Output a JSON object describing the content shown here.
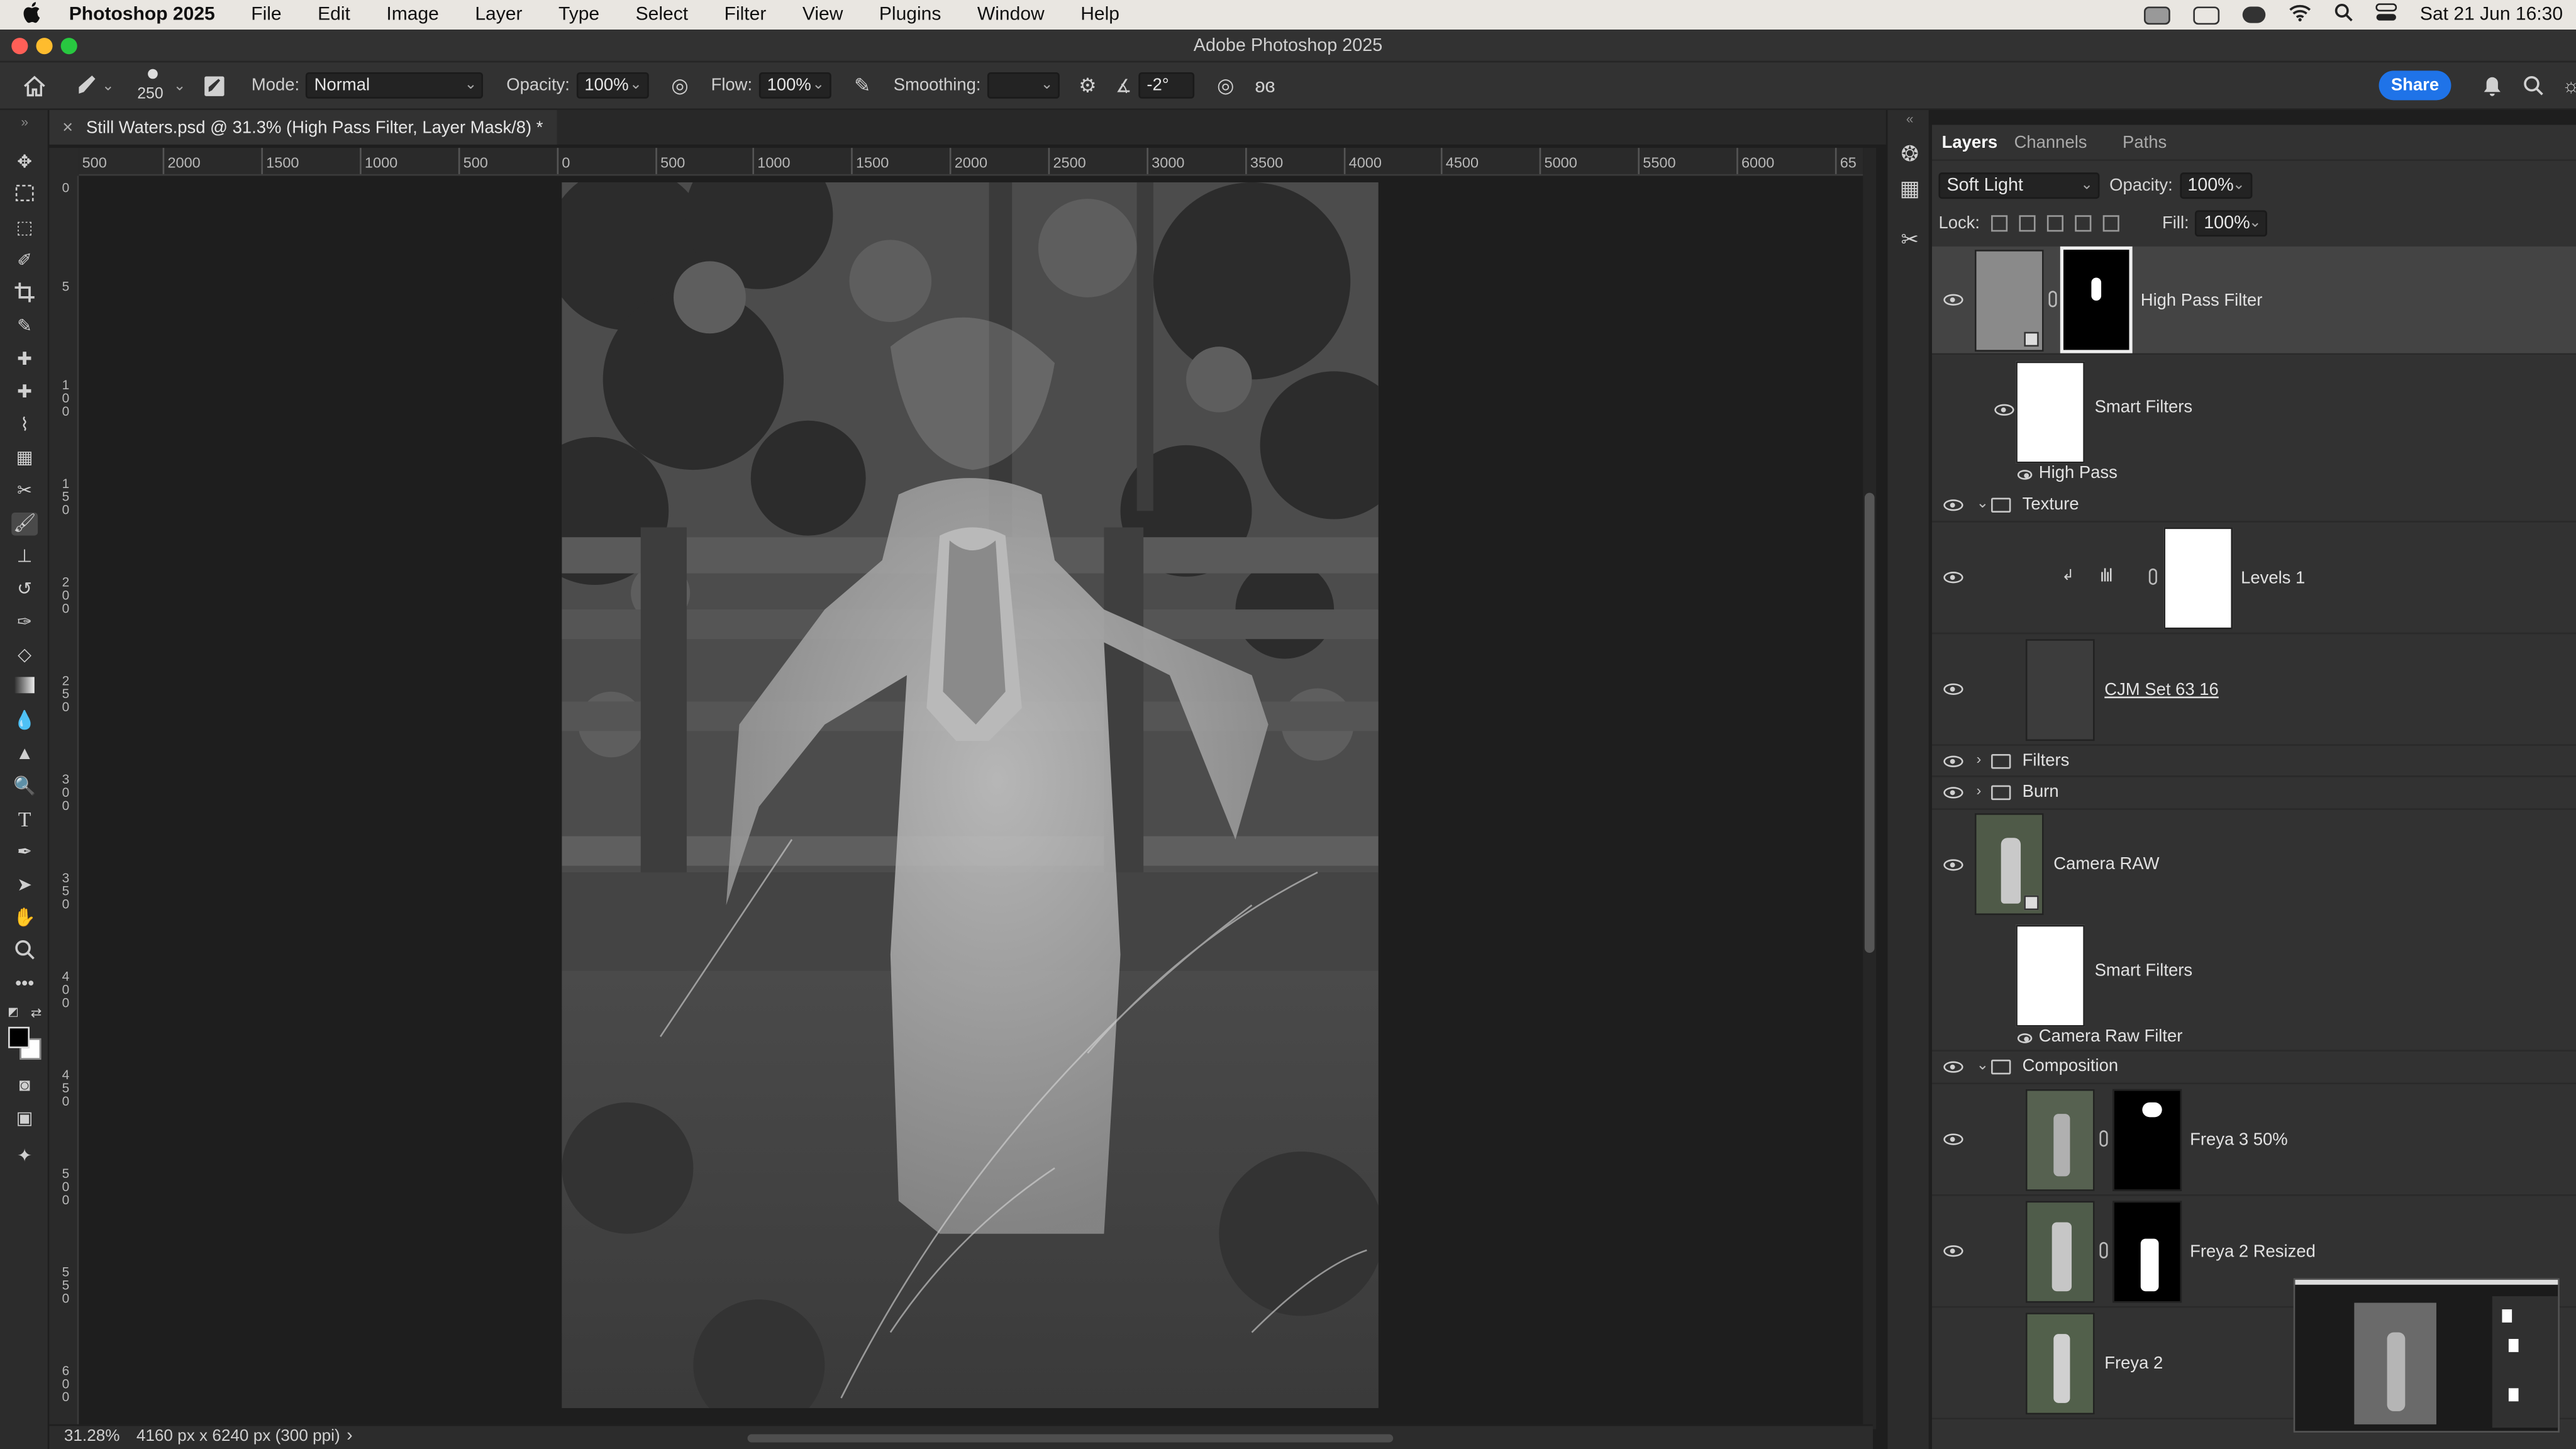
{
  "menubar": {
    "apple": "",
    "app_name": "Photoshop 2025",
    "items": [
      "File",
      "Edit",
      "Image",
      "Layer",
      "Type",
      "Select",
      "Filter",
      "View",
      "Plugins",
      "Window",
      "Help"
    ],
    "clock": "Sat 21 Jun  16:30"
  },
  "window": {
    "title": "Adobe Photoshop 2025"
  },
  "options": {
    "brush_size": "250",
    "mode_label": "Mode:",
    "mode_value": "Normal",
    "opacity_label": "Opacity:",
    "opacity_value": "100%",
    "flow_label": "Flow:",
    "flow_value": "100%",
    "smoothing_label": "Smoothing:",
    "smoothing_value": "",
    "angle_value": "-2°",
    "share_label": "Share"
  },
  "document": {
    "tab_title": "Still Waters.psd @ 31.3% (High Pass Filter, Layer Mask/8) *",
    "close_glyph": "×",
    "zoom": "31.28%",
    "info": "4160 px x 6240 px (300 ppi)",
    "info_chevron": "›"
  },
  "rulers": {
    "horizontal": [
      "500",
      "2000",
      "1500",
      "1000",
      "500",
      "0",
      "500",
      "1000",
      "1500",
      "2000",
      "2500",
      "3000",
      "3500",
      "4000",
      "4500",
      "5000",
      "5500",
      "6000",
      "65"
    ],
    "vertical": [
      "0",
      "5",
      "1 0 0",
      "1 5 0",
      "2 0 0",
      "2 5 0",
      "3 0 0",
      "3 5 0",
      "4 0 0",
      "4 5 0",
      "5 0 0",
      "5 5 0",
      "6 0 0"
    ]
  },
  "panel": {
    "tabs": [
      "Layers",
      "Channels",
      "Paths"
    ],
    "active_tab": "Layers",
    "blend_mode": "Soft Light",
    "opacity_label": "Opacity:",
    "opacity_value": "100%",
    "lock_label": "Lock:",
    "fill_label": "Fill:",
    "fill_value": "100%",
    "layers": [
      {
        "name": "High Pass Filter",
        "kind": "smart-object-with-mask",
        "visible": true,
        "selected": true
      },
      {
        "name": "Smart Filters",
        "kind": "smart-filters"
      },
      {
        "name": "High Pass",
        "kind": "filter"
      },
      {
        "name": "Texture",
        "kind": "group",
        "expanded": true,
        "visible": true
      },
      {
        "name": "Levels 1",
        "kind": "adjustment",
        "visible": true
      },
      {
        "name": "CJM Set 63 16",
        "kind": "layer",
        "visible": true
      },
      {
        "name": "Filters",
        "kind": "group",
        "expanded": false,
        "visible": true
      },
      {
        "name": "Burn",
        "kind": "group",
        "expanded": false,
        "visible": true
      },
      {
        "name": "Camera RAW",
        "kind": "smart-object",
        "visible": true
      },
      {
        "name": "Smart Filters",
        "kind": "smart-filters"
      },
      {
        "name": "Camera Raw Filter",
        "kind": "filter"
      },
      {
        "name": "Composition",
        "kind": "group",
        "expanded": true,
        "visible": true
      },
      {
        "name": "Freya 3 50%",
        "kind": "layer-with-mask",
        "visible": true
      },
      {
        "name": "Freya 2 Resized",
        "kind": "layer-with-mask",
        "visible": true
      },
      {
        "name": "Freya 2",
        "kind": "layer",
        "visible": false
      }
    ]
  },
  "colors": {
    "accent": "#1f73e8",
    "panel_bg": "#323232",
    "canvas_bg": "#1e1e1e",
    "menubar_bg": "#e9e6e1"
  }
}
